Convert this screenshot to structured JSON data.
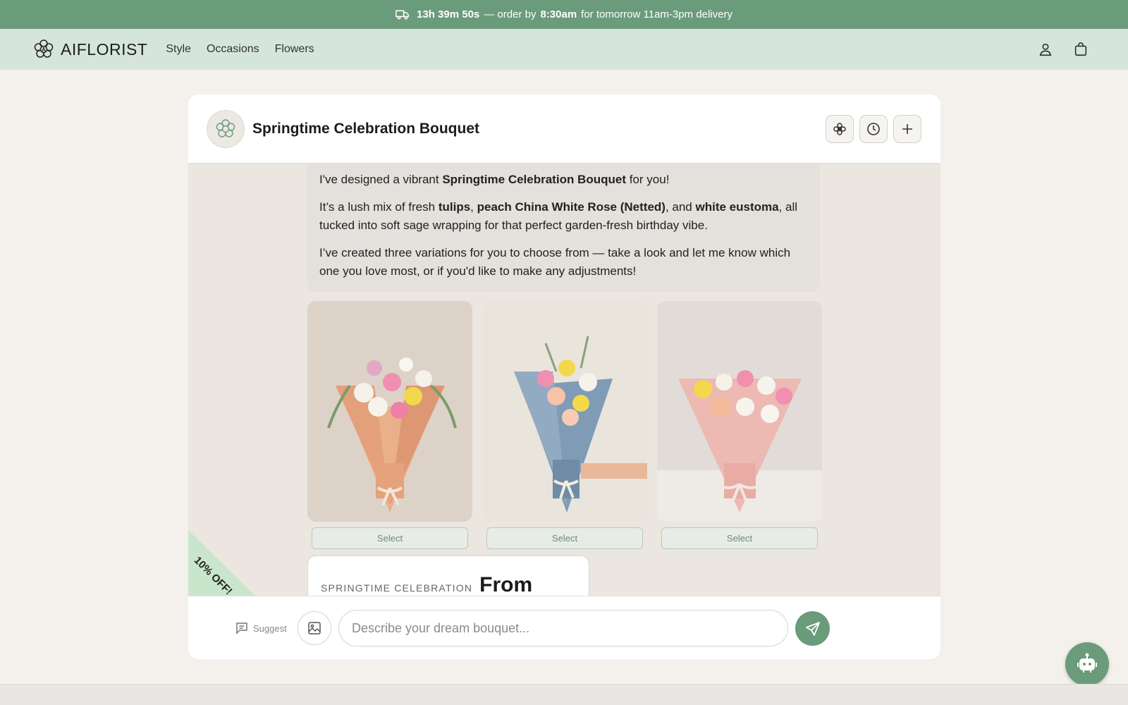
{
  "banner": {
    "countdown": "13h 39m 50s",
    "text_1": "— order by",
    "order_time": "8:30am",
    "text_2": "for tomorrow 11am-3pm delivery"
  },
  "nav": {
    "brand": "AIFLORIST",
    "links": [
      "Style",
      "Occasions",
      "Flowers"
    ]
  },
  "card": {
    "title": "Springtime Celebration Bouquet"
  },
  "message": {
    "p1_a": "I've designed a vibrant",
    "p1_b": "Springtime Celebration Bouquet",
    "p1_c": "for you!",
    "p2_a": "It’s a lush mix of fresh",
    "p2_b": "tulips",
    "p2_c": ",",
    "p2_d": "peach China White Rose (Netted)",
    "p2_e": ", and",
    "p2_f": "white eustoma",
    "p2_g": ", all tucked into soft sage wrapping for that perfect garden-fresh birthday vibe.",
    "p3": "I’ve created three variations for you to choose from — take a look and let me know which one you love most, or if you'd like to make any adjustments!"
  },
  "variants": [
    {
      "select_label": "Select",
      "wrap_color": "#e9b08a"
    },
    {
      "select_label": "Select",
      "wrap_color": "#7f9bb5"
    },
    {
      "select_label": "Select",
      "wrap_color": "#edb9b3"
    }
  ],
  "price_card": {
    "label": "SPRINGTIME CELEBRATION",
    "from": "From"
  },
  "ribbon": {
    "text": "10% OFF!"
  },
  "composer": {
    "suggest_label": "Suggest",
    "placeholder": "Describe your dream bouquet..."
  },
  "colors": {
    "accent": "#6a9b7a",
    "nav_bg": "#d5e5dc",
    "page_bg": "#f4f0eb"
  }
}
